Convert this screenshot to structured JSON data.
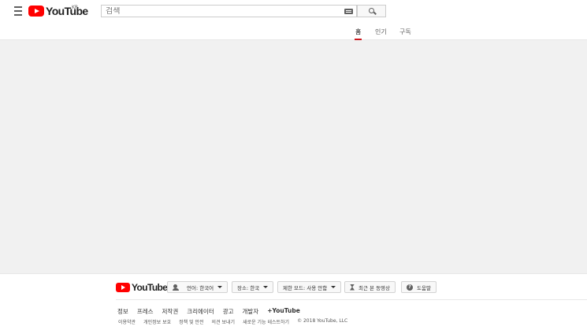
{
  "masthead": {
    "logo_text": "YouTube",
    "country_code": "KR",
    "search_placeholder": "검색",
    "search_value": ""
  },
  "tabs": [
    {
      "label": "홈",
      "active": true
    },
    {
      "label": "인기",
      "active": false
    },
    {
      "label": "구독",
      "active": false
    }
  ],
  "footer": {
    "logo_text": "YouTube",
    "buttons": {
      "language": "언어: 한국어",
      "location": "장소: 한국",
      "restricted": "제한 모드: 사용 안함",
      "history": "최근 본 동영상",
      "help": "도움말"
    },
    "links_primary": [
      "정보",
      "프레스",
      "저작권",
      "크리에이터",
      "광고",
      "개발자",
      "+YouTube"
    ],
    "links_secondary": [
      "이용약관",
      "개인정보 보호",
      "정책 및 안전",
      "의견 보내기",
      "새로운 기능 테스트하기"
    ],
    "copyright": "© 2018 YouTube, LLC"
  },
  "colors": {
    "brand_red": "#ff0000",
    "tab_indicator": "#cc181e",
    "content_bg": "#f1f1f1"
  },
  "icons": [
    "menu-icon",
    "youtube-logo-icon",
    "keyboard-icon",
    "search-icon",
    "language-icon",
    "history-icon",
    "help-icon"
  ]
}
